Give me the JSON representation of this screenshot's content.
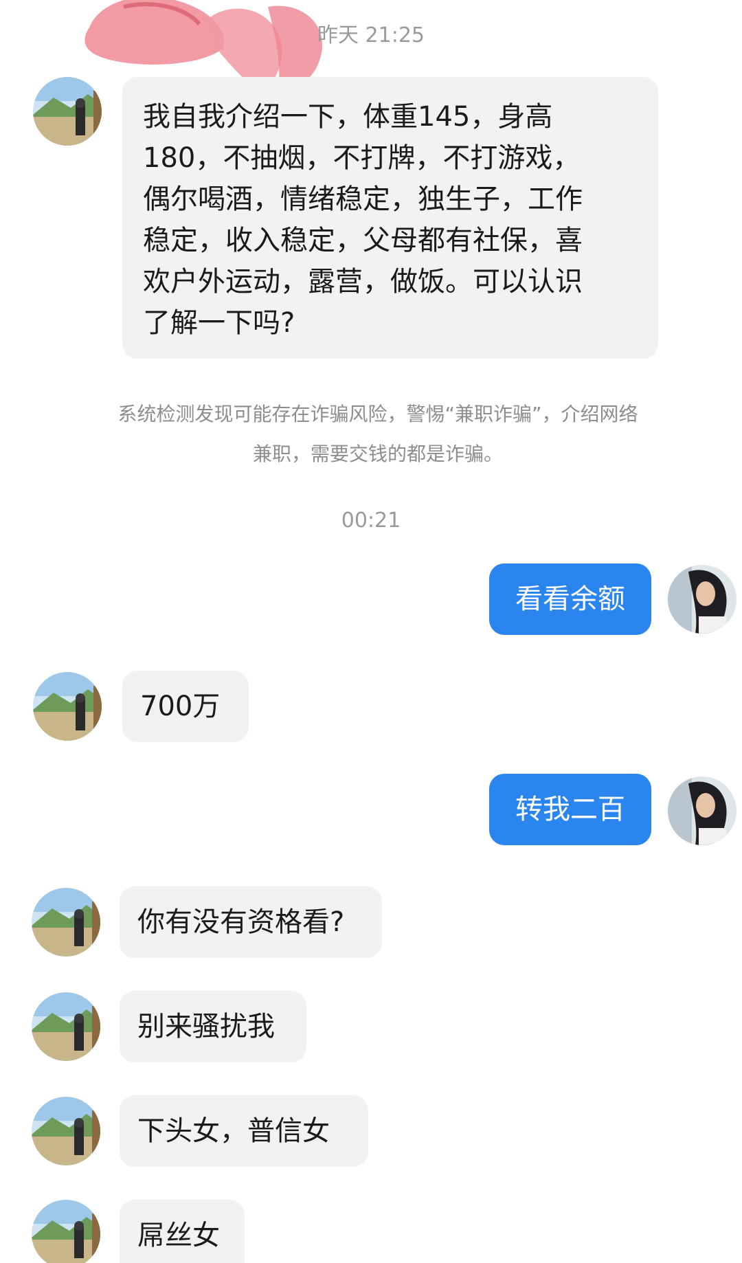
{
  "timestamps": {
    "first": "昨天 21:25",
    "second": "00:21"
  },
  "system_notice": {
    "line1": "系统检测发现可能存在诈骗风险，警惕“兼职诈骗”，介绍网络",
    "line2": "兼职，需要交钱的都是诈骗。"
  },
  "messages": [
    {
      "sender": "other",
      "lines": [
        "我自我介绍一下，体重145，身高",
        "180，不抽烟，不打牌，不打游戏，",
        "偶尔喝酒，情绪稳定，独生子，工作",
        "稳定，收入稳定，父母都有社保，喜",
        "欢户外运动，露营，做饭。可以认识",
        "了解一下吗?"
      ]
    },
    {
      "sender": "me",
      "text": "看看余额"
    },
    {
      "sender": "other",
      "text": "700万"
    },
    {
      "sender": "me",
      "text": "转我二百"
    },
    {
      "sender": "other",
      "text": "你有没有资格看?"
    },
    {
      "sender": "other",
      "text": "别来骚扰我"
    },
    {
      "sender": "other",
      "text": "下头女，普信女"
    },
    {
      "sender": "other",
      "text": "屌丝女"
    }
  ],
  "colors": {
    "outgoing_bubble": "#2b85ee",
    "incoming_bubble": "#f2f2f4",
    "timestamp_text": "#9a9a9a"
  },
  "icons": {
    "other_avatar": "landscape-photo-avatar",
    "my_avatar": "person-photo-avatar"
  }
}
